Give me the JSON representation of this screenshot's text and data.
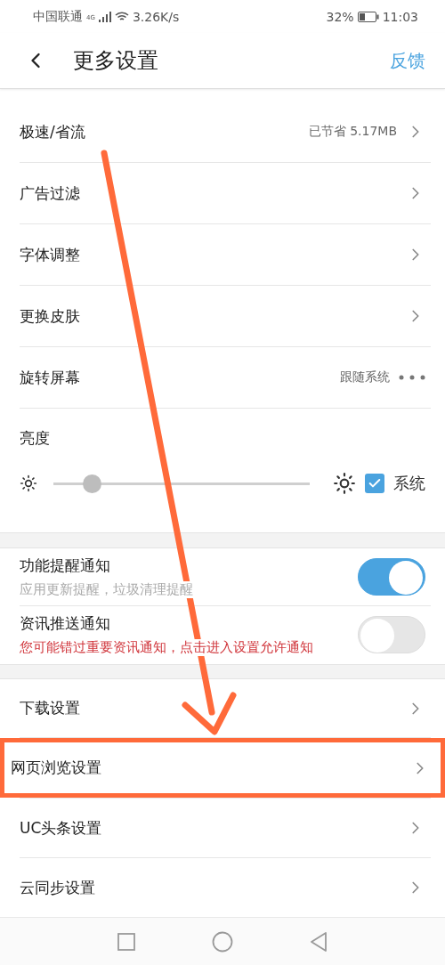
{
  "status_bar": {
    "carrier": "中国联通",
    "network": "4G",
    "speed": "3.26K/s",
    "battery": "32%",
    "time": "11:03"
  },
  "header": {
    "title": "更多设置",
    "action": "反馈"
  },
  "general_rows": [
    {
      "kind": "link",
      "label": "极速/省流",
      "value": "已节省 5.17MB"
    },
    {
      "kind": "link",
      "label": "广告过滤"
    },
    {
      "kind": "link",
      "label": "字体调整"
    },
    {
      "kind": "link",
      "label": "更换皮肤"
    },
    {
      "kind": "menu",
      "label": "旋转屏幕",
      "value": "跟随系统"
    }
  ],
  "brightness": {
    "label": "亮度",
    "level": 0.15,
    "system": {
      "label": "系统",
      "checked": true
    }
  },
  "notifications": [
    {
      "title": "功能提醒通知",
      "note": "应用更新提醒，垃圾清理提醒",
      "kind": "hint",
      "on": true
    },
    {
      "title": "资讯推送通知",
      "note": "您可能错过重要资讯通知，点击进入设置允许通知",
      "kind": "warning",
      "on": false
    }
  ],
  "more_rows": [
    {
      "label": "下载设置",
      "highlighted": false
    },
    {
      "label": "网页浏览设置",
      "highlighted": true
    },
    {
      "label": "UC头条设置",
      "highlighted": false
    },
    {
      "label": "云同步设置",
      "highlighted": false
    }
  ],
  "annotation": {
    "arrow": true
  }
}
